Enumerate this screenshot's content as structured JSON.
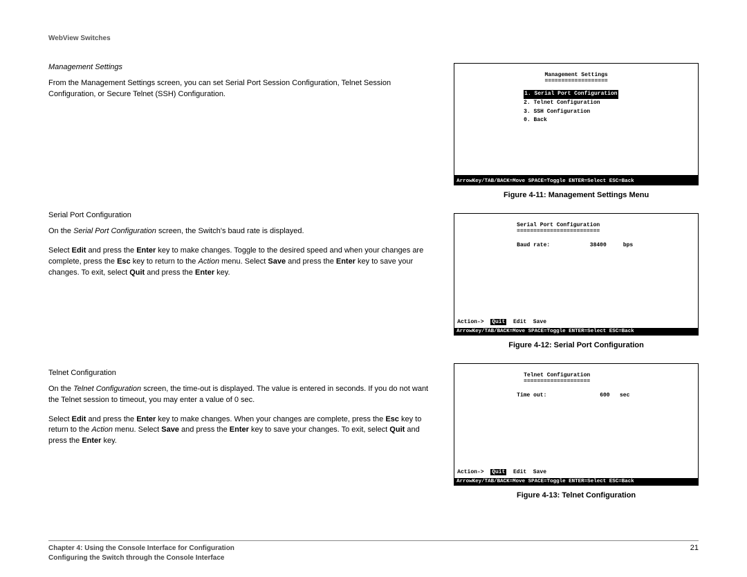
{
  "header": "WebView Switches",
  "mgmt": {
    "heading": "Management Settings",
    "intro": "From the Management Settings screen, you can set Serial Port Session Configuration, Telnet Session Configuration, or Secure Telnet (SSH) Configuration."
  },
  "serial": {
    "heading": "Serial Port Configuration",
    "p1_a": "On the ",
    "p1_i": "Serial Port Configuration",
    "p1_b": " screen, the Switch's baud rate is displayed.",
    "p2_a": "Select ",
    "p2_edit": "Edit",
    "p2_b": " and press the ",
    "p2_enter": "Enter",
    "p2_c": " key to make changes. Toggle to the desired speed and when your changes are complete, press the ",
    "p2_esc": "Esc",
    "p2_d": " key to return to the ",
    "p2_action": "Action",
    "p2_e": " menu. Select ",
    "p2_save": "Save",
    "p2_f": " and press the ",
    "p2_enter2": "Enter",
    "p2_g": " key to save your changes. To exit, select ",
    "p2_quit": "Quit",
    "p2_h": " and press the ",
    "p2_enter3": "Enter",
    "p2_i2": " key."
  },
  "telnet": {
    "heading": "Telnet Configuration",
    "p1_a": "On the ",
    "p1_i": "Telnet Configuration",
    "p1_b": " screen, the time-out is displayed. The value is entered in seconds. If you do not want the Telnet session to timeout, you may enter a value of 0 sec.",
    "p2_a": "Select ",
    "p2_edit": "Edit",
    "p2_b": " and press the ",
    "p2_enter": "Enter",
    "p2_c": " key to make changes. When your changes are complete, press the ",
    "p2_esc": "Esc",
    "p2_d": " key to return to the ",
    "p2_action": "Action",
    "p2_e": " menu. Select ",
    "p2_save": "Save",
    "p2_f": " and press the ",
    "p2_enter2": "Enter",
    "p2_g": " key to save your changes. To exit, select ",
    "p2_quit": "Quit",
    "p2_h": " and press the ",
    "p2_enter3": "Enter",
    "p2_i2": " key."
  },
  "fig11": {
    "title": "Management Settings",
    "under": "===================",
    "items": [
      "1. Serial Port Configuration",
      "2. Telnet Configuration",
      "3. SSH Configuration",
      "0. Back"
    ],
    "bar": "ArrowKey/TAB/BACK=Move  SPACE=Toggle  ENTER=Select  ESC=Back",
    "caption": "Figure 4-11: Management Settings Menu"
  },
  "fig12": {
    "title": "Serial Port Configuration",
    "under": "=========================",
    "label": "Baud rate:",
    "value": "38400",
    "unit": "bps",
    "action_l": "Action->",
    "action_sel": "Quit",
    "action_r1": "Edit",
    "action_r2": "Save",
    "bar": "ArrowKey/TAB/BACK=Move  SPACE=Toggle  ENTER=Select  ESC=Back",
    "caption": "Figure 4-12: Serial Port Configuration"
  },
  "fig13": {
    "title": "Telnet Configuration",
    "under": "====================",
    "label": "Time out:",
    "value": "600",
    "unit": "sec",
    "action_l": "Action->",
    "action_sel": "Quit",
    "action_r1": "Edit",
    "action_r2": "Save",
    "bar": "ArrowKey/TAB/BACK=Move  SPACE=Toggle  ENTER=Select  ESC=Back",
    "caption": "Figure 4-13: Telnet Configuration"
  },
  "footer": {
    "line1": "Chapter 4: Using the Console Interface for Configuration",
    "line2": "Configuring the Switch through the Console Interface",
    "page": "21"
  }
}
